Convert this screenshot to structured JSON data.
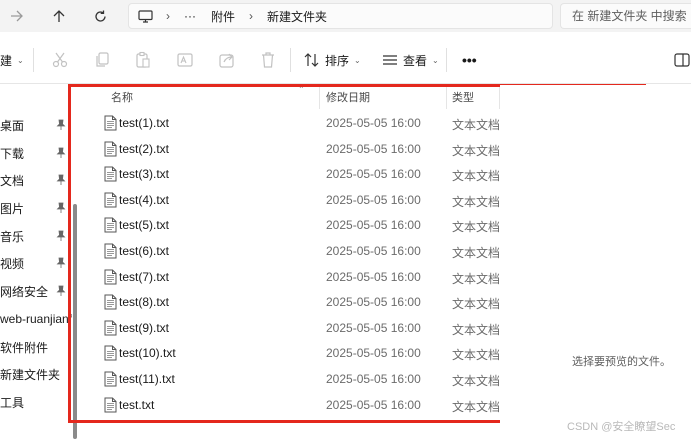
{
  "address_bar": {
    "path": [
      "···",
      "附件",
      "新建文件夹"
    ],
    "search_placeholder": "在 新建文件夹 中搜索"
  },
  "command_bar": {
    "new_label": "建",
    "sort_label": "排序",
    "view_label": "查看",
    "more_label": "•••"
  },
  "navigation": {
    "items": [
      {
        "label": "桌面",
        "pinned": true
      },
      {
        "label": "下载",
        "pinned": true
      },
      {
        "label": "文档",
        "pinned": true
      },
      {
        "label": "图片",
        "pinned": true
      },
      {
        "label": "音乐",
        "pinned": true
      },
      {
        "label": "视频",
        "pinned": true
      },
      {
        "label": "网络安全",
        "pinned": true
      },
      {
        "label": "web-ruanjianf",
        "pinned": false
      },
      {
        "label": "软件附件",
        "pinned": false
      },
      {
        "label": "新建文件夹",
        "pinned": false
      },
      {
        "label": "工具",
        "pinned": false
      }
    ]
  },
  "file_list": {
    "columns": {
      "name": "名称",
      "modified": "修改日期",
      "type": "类型"
    },
    "files": [
      {
        "name": "test(1).txt",
        "modified": "2025-05-05 16:00",
        "type": "文本文档"
      },
      {
        "name": "test(2).txt",
        "modified": "2025-05-05 16:00",
        "type": "文本文档"
      },
      {
        "name": "test(3).txt",
        "modified": "2025-05-05 16:00",
        "type": "文本文档"
      },
      {
        "name": "test(4).txt",
        "modified": "2025-05-05 16:00",
        "type": "文本文档"
      },
      {
        "name": "test(5).txt",
        "modified": "2025-05-05 16:00",
        "type": "文本文档"
      },
      {
        "name": "test(6).txt",
        "modified": "2025-05-05 16:00",
        "type": "文本文档"
      },
      {
        "name": "test(7).txt",
        "modified": "2025-05-05 16:00",
        "type": "文本文档"
      },
      {
        "name": "test(8).txt",
        "modified": "2025-05-05 16:00",
        "type": "文本文档"
      },
      {
        "name": "test(9).txt",
        "modified": "2025-05-05 16:00",
        "type": "文本文档"
      },
      {
        "name": "test(10).txt",
        "modified": "2025-05-05 16:00",
        "type": "文本文档"
      },
      {
        "name": "test(11).txt",
        "modified": "2025-05-05 16:00",
        "type": "文本文档"
      },
      {
        "name": "test.txt",
        "modified": "2025-05-05 16:00",
        "type": "文本文档"
      }
    ]
  },
  "preview": {
    "message": "选择要预览的文件。"
  },
  "watermark": "CSDN @安全瞭望Sec",
  "colors": {
    "highlight": "#e4281d",
    "background": "#ffffff",
    "toolbar_bg": "#f3f3f3"
  }
}
